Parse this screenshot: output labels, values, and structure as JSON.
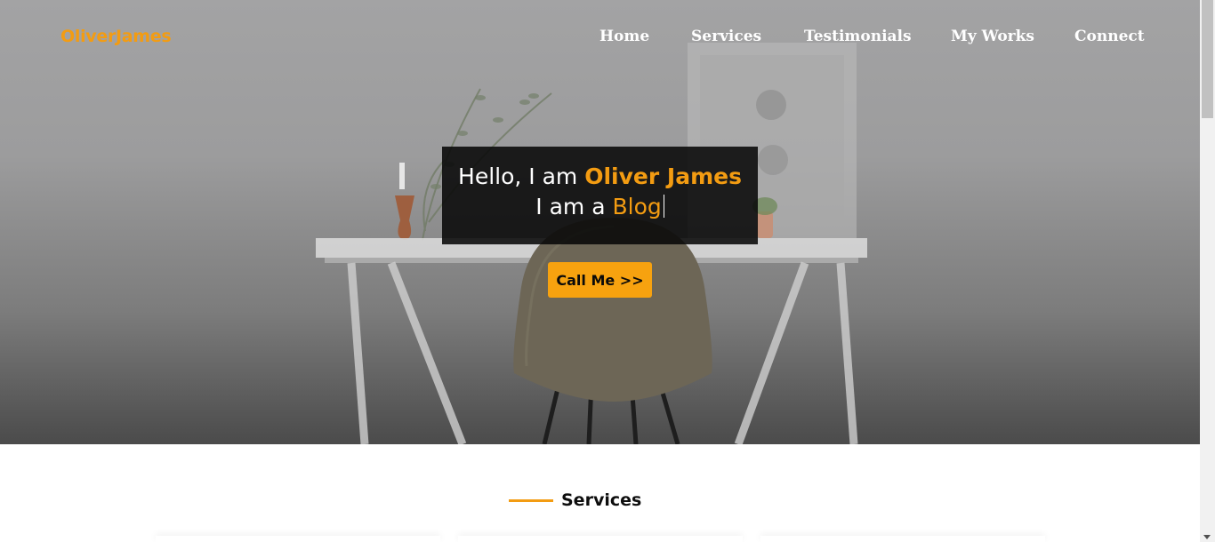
{
  "header": {
    "logo": "OliverJames",
    "nav": [
      {
        "label": "Home"
      },
      {
        "label": "Services"
      },
      {
        "label": "Testimonials"
      },
      {
        "label": "My Works"
      },
      {
        "label": "Connect"
      }
    ]
  },
  "hero": {
    "greeting": "Hello, I am",
    "name": "Oliver James",
    "role_prefix": "I am a",
    "role": "Blog",
    "cta_label": "Call Me >>"
  },
  "services": {
    "heading": "Services"
  },
  "colors": {
    "accent": "#f39c12",
    "button": "#f7a20f",
    "intro_box": "#080808",
    "nav_text": "#ffffff"
  },
  "icons": {
    "scroll_down": "chevron-down-icon"
  }
}
